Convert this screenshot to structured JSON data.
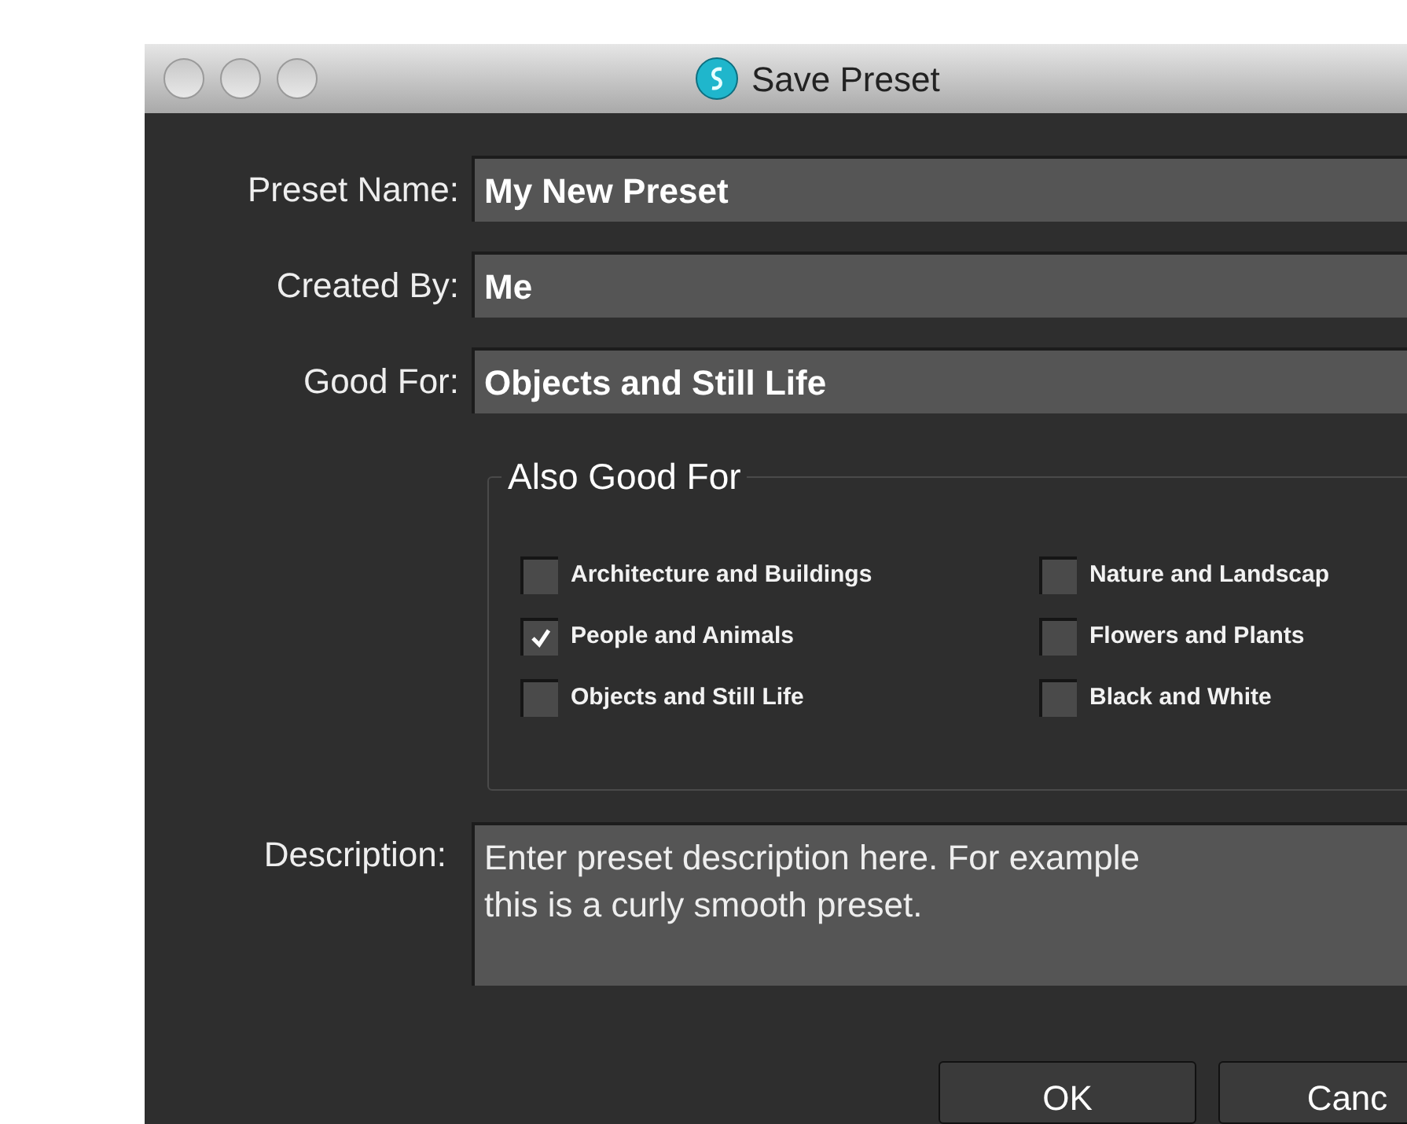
{
  "window": {
    "title": "Save Preset"
  },
  "fields": [
    {
      "label": "Preset Name:",
      "value": "My New Preset"
    },
    {
      "label": "Created By:",
      "value": "Me"
    },
    {
      "label": "Good For:",
      "value": "Objects and Still Life"
    }
  ],
  "also_good_for": {
    "title": "Also Good For",
    "options": [
      {
        "label": "Architecture and Buildings",
        "checked": false
      },
      {
        "label": "Nature and Landscap",
        "checked": false
      },
      {
        "label": "People and Animals",
        "checked": true
      },
      {
        "label": "Flowers and Plants",
        "checked": false
      },
      {
        "label": "Objects and Still Life",
        "checked": false
      },
      {
        "label": "Black and White",
        "checked": false
      }
    ]
  },
  "description": {
    "label": "Description:",
    "value": "Enter preset description here. For example this is a curly smooth preset."
  },
  "buttons": [
    "OK",
    "Canc"
  ]
}
